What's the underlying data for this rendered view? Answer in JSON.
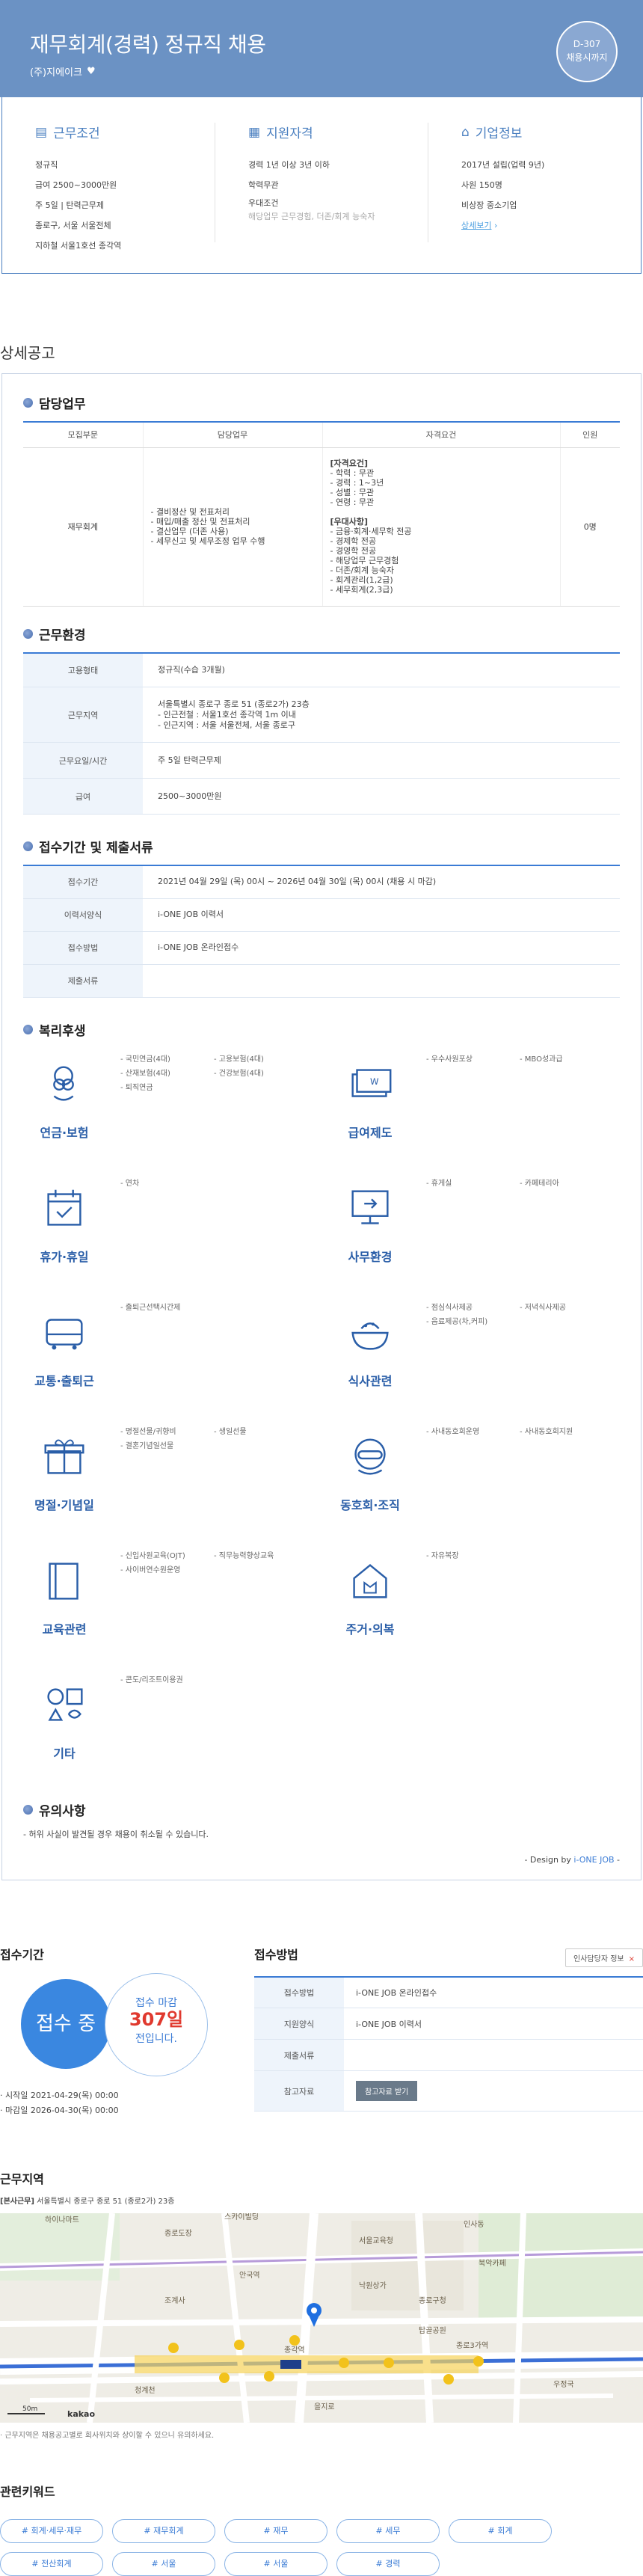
{
  "header": {
    "title": "재무회계(경력) 정규직 채용",
    "company": "(주)지에이크",
    "dday": "D-307",
    "dday_sub": "채용시까지"
  },
  "summary": {
    "conditions": {
      "title": "근무조건",
      "lines": [
        "정규직",
        "급여 2500~3000만원",
        "주 5일 | 탄력근무제",
        "종로구, 서울 서울전체",
        "지하철 서울1호선 종각역"
      ]
    },
    "qualification": {
      "title": "지원자격",
      "lines": [
        "경력 1년 이상 3년 이하",
        "학력무관",
        "우대조건"
      ],
      "pref": "해당업무 근무경험, 더존/회계 능숙자"
    },
    "company": {
      "title": "기업정보",
      "lines": [
        "2017년 설립(업력 9년)",
        "사원 150명",
        "비상장 중소기업"
      ],
      "link": "상세보기"
    }
  },
  "section_title": "상세공고",
  "duty": {
    "title": "담당업무",
    "headers": [
      "모집부문",
      "담당업무",
      "자격요건",
      "인원"
    ],
    "row": {
      "dept": "재무회계",
      "tasks": [
        "- 결비정산 및 전표처리",
        "- 매입/매출 정산 및 전표처리",
        "- 결산업무 (더존 사용)",
        "- 세무신고 및 세무조정 업무 수행"
      ],
      "qual_head": "[자격요건]",
      "quals": [
        "- 학력 : 무관",
        "- 경력 : 1~3년",
        "- 성별 : 무관",
        "- 연령 : 무관"
      ],
      "pref_head": "[우대사항]",
      "prefs": [
        "- 금융·회계·세무학 전공",
        "- 경제학 전공",
        "- 경영학 전공",
        "- 해당업무 근무경험",
        "- 더존/회계 능숙자",
        "- 회계관리(1,2급)",
        "- 세무회계(2,3급)"
      ],
      "count": "0명"
    }
  },
  "env": {
    "title": "근무환경",
    "rows": [
      {
        "k": "고용형태",
        "v": "정규직(수습 3개월)"
      },
      {
        "k": "근무지역",
        "v": "서울특별시 종로구 종로 51 (종로2가) 23층",
        "v2": "- 인근전철 : 서울1호선 종각역 1m 이내",
        "v3": "- 인근지역 : 서울 서울전체, 서울 종로구"
      },
      {
        "k": "근무요일/시간",
        "v": "주 5일 탄력근무제"
      },
      {
        "k": "급여",
        "v": "2500~3000만원"
      }
    ]
  },
  "apply": {
    "title": "접수기간 및 제출서류",
    "rows": [
      {
        "k": "접수기간",
        "v": "2021년 04월 29일 (목) 00시 ~ 2026년 04월 30일 (목) 00시 (채용 시 마감)"
      },
      {
        "k": "이력서양식",
        "v": "i-ONE JOB 이력서"
      },
      {
        "k": "접수방법",
        "v": "i-ONE JOB 온라인접수"
      },
      {
        "k": "제출서류",
        "v": ""
      }
    ]
  },
  "benefits": {
    "title": "복리후생",
    "items": [
      {
        "label": "연금·보험",
        "icon": "pension-icon",
        "list": [
          "- 국민연금(4대)",
          "- 고용보험(4대)",
          "- 산재보험(4대)",
          "- 건강보험(4대)",
          "- 퇴직연금"
        ]
      },
      {
        "label": "급여제도",
        "icon": "salary-icon",
        "list": [
          "- 우수사원포상",
          "- MBO성과급"
        ]
      },
      {
        "label": "휴가·휴일",
        "icon": "calendar-icon",
        "list": [
          "- 연차"
        ]
      },
      {
        "label": "사무환경",
        "icon": "monitor-icon",
        "list": [
          "- 휴게실",
          "- 카페테리아"
        ]
      },
      {
        "label": "교통·출퇴근",
        "icon": "bus-icon",
        "list": [
          "- 출퇴근선택시간제"
        ]
      },
      {
        "label": "식사관련",
        "icon": "meal-icon",
        "list": [
          "- 점심식사제공",
          "- 저녁식사제공",
          "- 음료제공(차,커피)"
        ]
      },
      {
        "label": "명절·기념일",
        "icon": "gift-icon",
        "list": [
          "- 명절선물/귀향비",
          "- 생일선물",
          "- 결혼기념일선물"
        ]
      },
      {
        "label": "동호회·조직",
        "icon": "club-icon",
        "list": [
          "- 사내동호회운영",
          "- 사내동호회지원"
        ]
      },
      {
        "label": "교육관련",
        "icon": "book-icon",
        "list": [
          "- 신입사원교육(OJT)",
          "- 직무능력향상교육",
          "- 사이버연수원운영"
        ]
      },
      {
        "label": "주거·의복",
        "icon": "house-icon",
        "list": [
          "- 자유복장"
        ]
      },
      {
        "label": "기타",
        "icon": "shapes-icon",
        "list": [
          "- 콘도/리조트이용권"
        ]
      }
    ]
  },
  "notice": {
    "title": "유의사항",
    "text": "- 허위 사실이 발견될 경우 채용이 취소될 수 있습니다.",
    "design_prefix": "- Design by ",
    "design_brand": "i-ONE JOB",
    "design_suffix": " -"
  },
  "period": {
    "title": "접수기간",
    "status": "접수 중",
    "remain_label": "접수 마감",
    "remain_days": "307일",
    "remain_suffix": "전입니다.",
    "start": "· 시작일 2021-04-29(목) 00:00",
    "end": "· 마감일 2026-04-30(목) 00:00"
  },
  "method": {
    "title": "접수방법",
    "contact_btn": "인사담당자 정보",
    "contact_x": "×",
    "rows": [
      {
        "k": "접수방법",
        "v": "i-ONE JOB 온라인접수"
      },
      {
        "k": "지원양식",
        "v": "i-ONE JOB 이력서"
      },
      {
        "k": "제출서류",
        "v": ""
      },
      {
        "k": "참고자료",
        "v": "",
        "btn": "참고자료 받기"
      }
    ]
  },
  "location": {
    "title": "근무지역",
    "address_tag": "[본사근무]",
    "address": "서울특별시 종로구 종로 51 (종로2가) 23층",
    "note": "· 근무지역은 채용공고별로 회사위치와 상이할 수 있으니 유의하세요.",
    "map_labels": [
      "하이나마트",
      "종로도장",
      "스카이빌딩",
      "인사동",
      "서울교육청",
      "안국역",
      "낙원상가",
      "종로구청",
      "종각역",
      "종로3가역",
      "을지로",
      "청계천",
      "북악카페",
      "탑골공원",
      "조계사",
      "우정국"
    ],
    "map_scale": "50m",
    "map_brand": "kakao"
  },
  "keywords": {
    "title": "관련키워드",
    "items": [
      "# 회계·세무·재무",
      "# 재무회계",
      "# 재무",
      "# 세무",
      "# 회계",
      "# 전산회계",
      "# 서울",
      "# 서울",
      "# 경력"
    ]
  }
}
